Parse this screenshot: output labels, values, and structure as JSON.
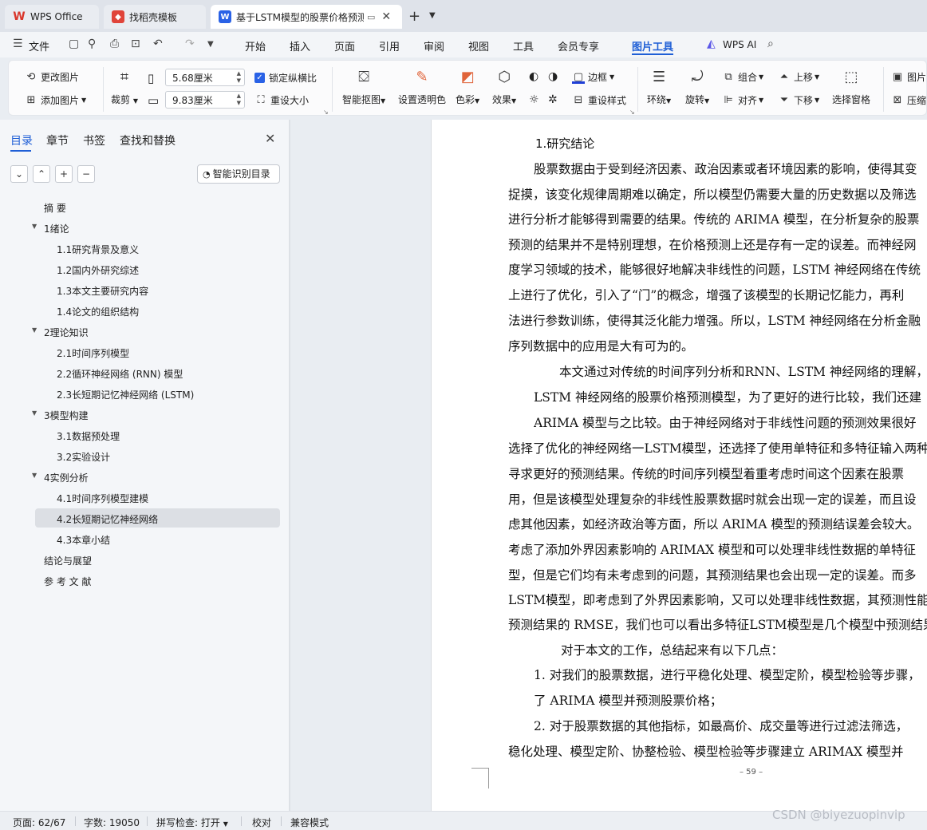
{
  "tabs": {
    "wps": "WPS Office",
    "template": "找稻壳模板",
    "doc": "基于LSTM模型的股票价格预测"
  },
  "menu": {
    "file": "文件",
    "items": [
      "开始",
      "插入",
      "页面",
      "引用",
      "审阅",
      "视图",
      "工具",
      "会员专享",
      "图片工具"
    ],
    "wps_ai": "WPS AI"
  },
  "ribbon": {
    "change_pic": "更改图片",
    "add_pic": "添加图片",
    "crop": "裁剪",
    "width": "5.68厘米",
    "height": "9.83厘米",
    "lock_ratio": "锁定纵横比",
    "reset_size": "重设大小",
    "smart_cutout": "智能抠图",
    "set_transparent": "设置透明色",
    "color": "色彩",
    "effect": "效果",
    "border": "边框",
    "reset_style": "重设样式",
    "wrap": "环绕",
    "rotate": "旋转",
    "group": "组合",
    "align": "对齐",
    "bring_up": "上移",
    "send_down": "下移",
    "selection_pane": "选择窗格",
    "picture": "图片",
    "compress": "压缩"
  },
  "panel": {
    "tabs": [
      "目录",
      "章节",
      "书签",
      "查找和替换"
    ],
    "smart_toc": "智能识别目录",
    "toc": [
      {
        "text": "摘  要",
        "level": 1
      },
      {
        "text": "1绪论",
        "level": 1
      },
      {
        "text": "1.1研究背景及意义",
        "level": 2
      },
      {
        "text": "1.2国内外研究综述",
        "level": 2
      },
      {
        "text": "1.3本文主要研究内容",
        "level": 2
      },
      {
        "text": "1.4论文的组织结构",
        "level": 2
      },
      {
        "text": "2理论知识",
        "level": 1
      },
      {
        "text": "2.1时间序列模型",
        "level": 2
      },
      {
        "text": "2.2循环神经网络 (RNN) 模型",
        "level": 2
      },
      {
        "text": "2.3长短期记忆神经网络 (LSTM)",
        "level": 2
      },
      {
        "text": "3模型构建",
        "level": 1
      },
      {
        "text": "3.1数据预处理",
        "level": 2
      },
      {
        "text": "3.2实验设计",
        "level": 2
      },
      {
        "text": "4实例分析",
        "level": 1
      },
      {
        "text": "4.1时间序列模型建模",
        "level": 2
      },
      {
        "text": "4.2长短期记忆神经网络",
        "level": 2
      },
      {
        "text": "4.3本章小结",
        "level": 2
      },
      {
        "text": "结论与展望",
        "level": 1
      },
      {
        "text": "参 考 文 献",
        "level": 1
      }
    ]
  },
  "doc": {
    "heading": "1.研究结论",
    "lines": [
      "股票数据由于受到经济因素、政治因素或者环境因素的影响，使得其变",
      "捉摸，该变化规律周期难以确定，所以模型仍需要大量的历史数据以及筛选",
      "进行分析才能够得到需要的结果。传统的 ARIMA 模型，在分析复杂的股票",
      "预测的结果并不是特别理想，在价格预测上还是存有一定的误差。而神经网",
      "度学习领域的技术，能够很好地解决非线性的问题，LSTM 神经网络在传统",
      "上进行了优化，引入了“门”的概念，增强了该模型的长期记忆能力，再利",
      "法进行参数训练，使得其泛化能力增强。所以，LSTM 神经网络在分析金融",
      "序列数据中的应用是大有可为的。",
      "本文通过对传统的时间序列分析和RNN、LSTM 神经网络的理解，构",
      "LSTM 神经网络的股票价格预测模型，为了更好的进行比较，我们还建",
      "ARIMA 模型与之比较。由于神经网络对于非线性问题的预测效果很好",
      "选择了优化的神经网络一LSTM模型，还选择了使用单特征和多特征输入两种",
      "寻求更好的预测结果。传统的时间序列模型着重考虑时间这个因素在股票",
      "用，但是该模型处理复杂的非线性股票数据时就会出现一定的误差，而且设",
      "虑其他因素，如经济政治等方面，所以 ARIMA 模型的预测结误差会较大。",
      "考虑了添加外界因素影响的 ARIMAX 模型和可以处理非线性数据的单特征",
      "型，但是它们均有未考虑到的问题，其预测结果也会出现一定的误差。而多",
      "LSTM模型，即考虑到了外界因素影响，又可以处理非线性数据，其预测性能",
      "预测结果的 RMSE，我们也可以看出多特征LSTM模型是几个模型中预测结果",
      "对于本文的工作，总结起来有以下几点：",
      "1.  对我们的股票数据，进行平稳化处理、模型定阶，模型检验等步骤，",
      "了  ARIMA 模型并预测股票价格；",
      "2.  对于股票数据的其他指标，如最高价、成交量等进行过滤法筛选，",
      "稳化处理、模型定阶、协整检验、模型检验等步骤建立  ARIMAX 模型并"
    ],
    "page_number": "– 59 –"
  },
  "status": {
    "page": "页面: 62/67",
    "words": "字数: 19050",
    "spell": "拼写检查: 打开",
    "proof": "校对",
    "compat": "兼容模式"
  },
  "watermark": "CSDN @biyezuopinvip"
}
